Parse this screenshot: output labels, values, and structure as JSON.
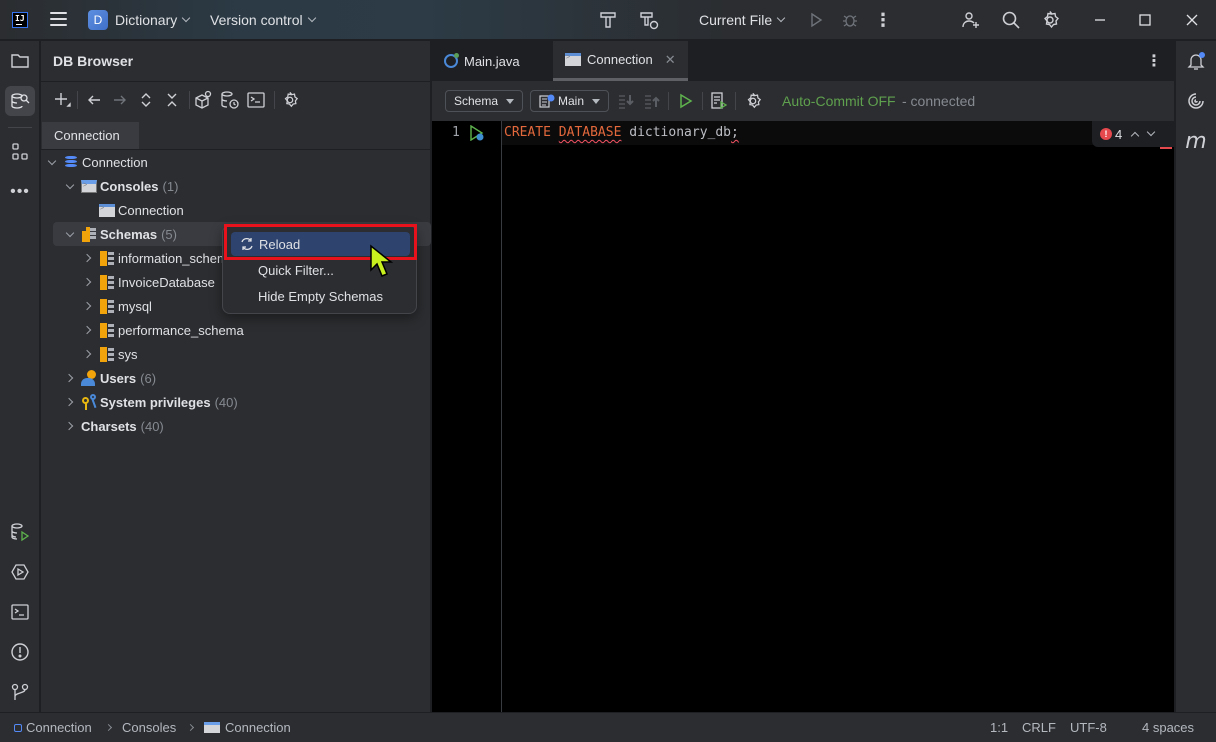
{
  "titlebar": {
    "app_logo": "IJ",
    "project_initial": "D",
    "project_name": "Dictionary",
    "vcs_label": "Version control",
    "run_config": "Current File",
    "icons": [
      "hamburger-menu-icon",
      "build-hammer-icon",
      "rebuild-icon",
      "run-icon",
      "debug-icon",
      "more-icon",
      "add-user-icon",
      "search-icon",
      "settings-gear-icon",
      "minimize-icon",
      "maximize-icon",
      "close-icon"
    ]
  },
  "left_strip": {
    "top_icons": [
      "project-folder-icon",
      "db-browser-icon",
      "structure-icon",
      "more-tools-icon"
    ],
    "bottom_icons": [
      "db-execution-icon",
      "services-icon",
      "terminal-icon",
      "problems-icon",
      "git-icon"
    ]
  },
  "db_browser": {
    "title": "DB Browser",
    "toolbar_icons": [
      "add-connection-icon",
      "back-icon",
      "forward-icon",
      "expand-all-icon",
      "collapse-all-icon",
      "object-search-icon",
      "history-icon",
      "console-icon",
      "settings-icon"
    ],
    "connection_tab": "Connection",
    "tree": {
      "root": "Connection",
      "consoles": {
        "label": "Consoles",
        "count": "(1)",
        "children": [
          "Connection"
        ]
      },
      "schemas": {
        "label": "Schemas",
        "count": "(5)",
        "children": [
          "information_schema",
          "InvoiceDatabase",
          "mysql",
          "performance_schema",
          "sys"
        ]
      },
      "users": {
        "label": "Users",
        "count": "(6)"
      },
      "privileges": {
        "label": "System privileges",
        "count": "(40)"
      },
      "charsets": {
        "label": "Charsets",
        "count": "(40)"
      }
    }
  },
  "context_menu": {
    "items": [
      "Reload",
      "Quick Filter...",
      "Hide Empty Schemas"
    ],
    "highlighted": "Reload"
  },
  "editor": {
    "tabs": [
      {
        "label": "Main.java",
        "active": false
      },
      {
        "label": "Connection",
        "active": true
      }
    ],
    "schema_combo": "Schema",
    "session_combo": "Main",
    "autocommit": "Auto-Commit OFF",
    "status": "- connected",
    "line_number": "1",
    "code": {
      "kw1": "CREATE",
      "kw2": "DATABASE",
      "ident": "dictionary_db",
      "semi": ";"
    },
    "problems_count": "4"
  },
  "right_strip": {
    "icons": [
      "notifications-icon",
      "ai-assistant-icon",
      "maven-icon"
    ],
    "maven_label": "m"
  },
  "statusbar": {
    "breadcrumbs": [
      "Connection",
      "Consoles",
      "Connection"
    ],
    "position": "1:1",
    "line_sep": "CRLF",
    "encoding": "UTF-8",
    "indent": "4 spaces"
  },
  "colors": {
    "accent": "#3574f0",
    "menu_highlight": "#2e436e",
    "annotation_red": "#e8121d",
    "keyword": "#e3683b",
    "autocommit_green": "#5fa04e"
  }
}
